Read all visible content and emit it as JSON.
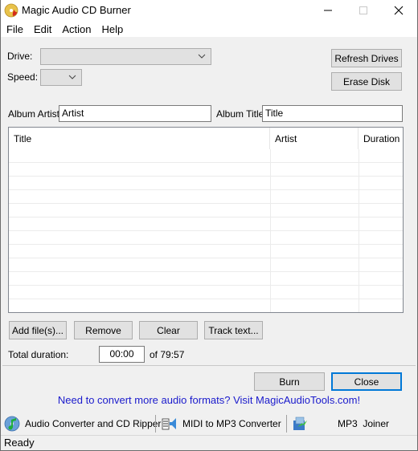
{
  "window": {
    "title": "Magic Audio CD Burner",
    "controls": {
      "minimize": "minimize",
      "maximize": "maximize",
      "close": "close"
    }
  },
  "menu": [
    "File",
    "Edit",
    "Action",
    "Help"
  ],
  "drive": {
    "label": "Drive:",
    "value": ""
  },
  "speed": {
    "label": "Speed:",
    "value": ""
  },
  "buttons": {
    "refresh_drives": "Refresh Drives",
    "erase_disk": "Erase Disk",
    "add_files": "Add file(s)...",
    "remove": "Remove",
    "clear": "Clear",
    "track_text": "Track text...",
    "burn": "Burn",
    "close": "Close"
  },
  "album": {
    "artist_label": "Album Artist:",
    "artist_value": "Artist",
    "title_label": "Album Title:",
    "title_value": "Title"
  },
  "tracklist": {
    "columns": [
      "Title",
      "Artist",
      "Duration"
    ],
    "rows": []
  },
  "duration": {
    "label": "Total duration:",
    "value": "00:00",
    "capacity": "of 79:57"
  },
  "promo_text": "Need to convert more audio formats? Visit MagicAudioTools.com!",
  "promo_color": "#1a1acc",
  "tools": [
    {
      "label": "Audio Converter and CD Ripper",
      "icon": "audio-converter-icon"
    },
    {
      "label": "MIDI to MP3 Converter",
      "icon": "midi-converter-icon"
    },
    {
      "label": "MP3  Joiner",
      "icon": "mp3-joiner-icon"
    }
  ],
  "status": "Ready"
}
